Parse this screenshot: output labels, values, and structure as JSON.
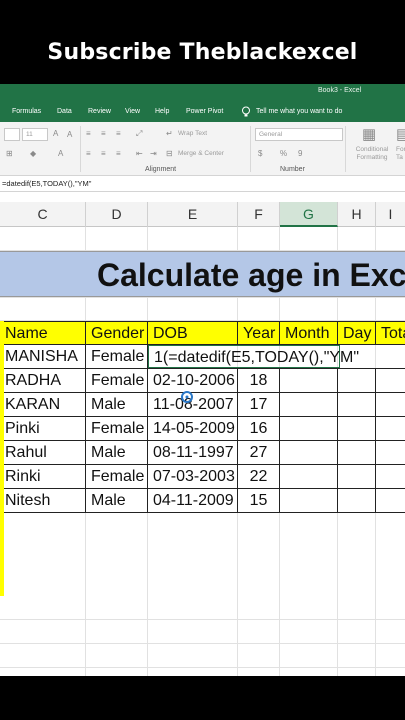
{
  "banner": {
    "text": "Subscribe Theblackexcel"
  },
  "window": {
    "title": "Book3 - Excel"
  },
  "ribbon": {
    "tabs": [
      "Formulas",
      "Data",
      "Review",
      "View",
      "Help",
      "Power Pivot"
    ],
    "tell_me": "Tell me what you want to do",
    "font_size": "11",
    "wrap_text": "Wrap Text",
    "merge_center": "Merge & Center",
    "number_format": "General",
    "alignment_group": "Alignment",
    "number_group": "Number",
    "conditional_formatting": "Conditional Formatting",
    "format_as_table": "For Ta",
    "number_buttons": [
      "$",
      "%",
      "9"
    ]
  },
  "formula_bar": {
    "text": "=datedif(E5,TODAY(),\"YM\""
  },
  "columns": [
    "C",
    "D",
    "E",
    "F",
    "G",
    "H",
    "I"
  ],
  "selected_column": "G",
  "sheet": {
    "title": "Calculate age in Excel",
    "headers": [
      "Name",
      "Gender",
      "DOB",
      "Year",
      "Month",
      "Day",
      "Total"
    ],
    "rows": [
      {
        "name": "MANISHA",
        "gender": "Female",
        "dob": "1(=datedif(E5,TODAY(),\"YM\"",
        "year": ""
      },
      {
        "name": "RADHA",
        "gender": "Female",
        "dob": "02-10-2006",
        "year": "18"
      },
      {
        "name": "KARAN",
        "gender": "Male",
        "dob": "11-08-2007",
        "year": "17"
      },
      {
        "name": "Pinki",
        "gender": "Female",
        "dob": "14-05-2009",
        "year": "16"
      },
      {
        "name": "Rahul",
        "gender": "Male",
        "dob": "08-11-1997",
        "year": "27"
      },
      {
        "name": "Rinki",
        "gender": "Female",
        "dob": "07-03-2003",
        "year": "22"
      },
      {
        "name": "Nitesh",
        "gender": "Male",
        "dob": "04-11-2009",
        "year": "15"
      }
    ]
  },
  "colors": {
    "excel_green": "#217346",
    "title_band": "#b4c7e7",
    "header_fill": "#ffff00"
  }
}
